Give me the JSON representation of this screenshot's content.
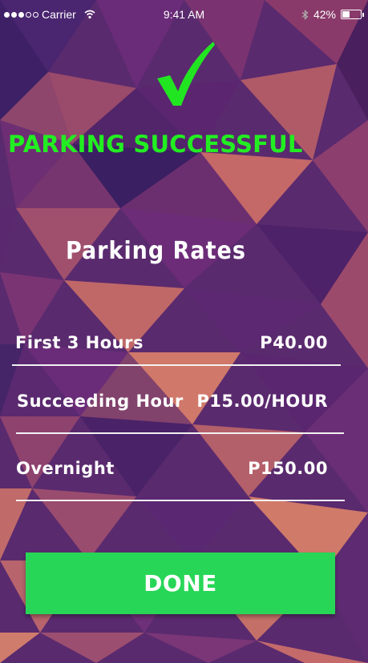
{
  "status_bar": {
    "carrier": "Carrier",
    "time": "9:41 AM",
    "battery": "42%",
    "battery_level": 0.42,
    "signal_bars": 3
  },
  "header": {
    "title": "PARKING SUCCESSFUL"
  },
  "rates": {
    "title": "Parking Rates",
    "items": [
      {
        "label": "First 3 Hours",
        "value": "P40.00"
      },
      {
        "label": "Succeeding Hour",
        "value": "P15.00/HOUR"
      },
      {
        "label": "Overnight",
        "value": "P150.00"
      }
    ]
  },
  "actions": {
    "done_label": "DONE"
  },
  "colors": {
    "accent": "#22ee22",
    "button": "#28d657",
    "background": "#5a2a6e"
  }
}
